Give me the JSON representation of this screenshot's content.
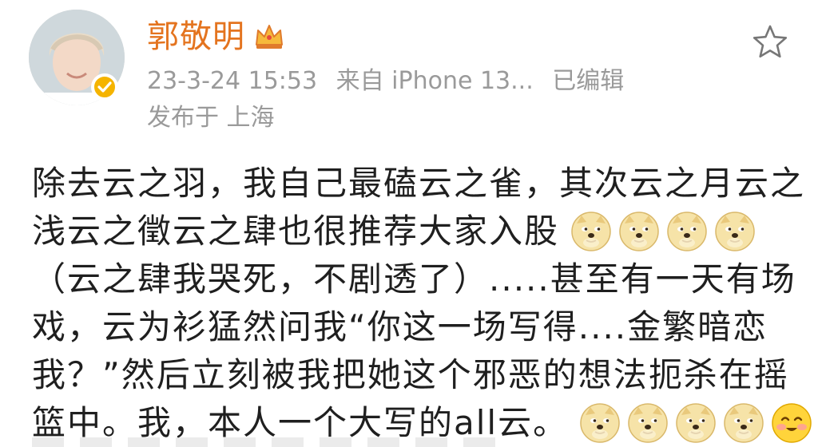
{
  "header": {
    "username": "郭敬明",
    "post_time": "23-3-24 15:53",
    "source": "来自 iPhone 13...",
    "edited": "已编辑",
    "location": "发布于 上海"
  },
  "icons": {
    "crown": "crown-icon",
    "verified": "verified-badge-icon",
    "favorite": "star-icon",
    "emoji_doge": "doge-emoji-icon",
    "emoji_smile": "smile-emoji-icon"
  },
  "colors": {
    "username": "#e4741f",
    "meta": "#9a9a9a",
    "badge": "#f5b400",
    "text": "#1f1f1f"
  },
  "post": {
    "lines": [
      "除去云之羽，我自己最磕云之雀，其次云之月云之",
      "浅云之徵云之肆也很推荐大家入股",
      "（云之肆我哭死，不剧透了）.....甚至有一天有场",
      "戏，云为衫猛然问我“你这一场写得....金繁暗恋",
      "我？”然后立刻被我把她这个邪恶的想法扼杀在摇",
      "篮中。我，本人一个大写的all云。"
    ]
  }
}
